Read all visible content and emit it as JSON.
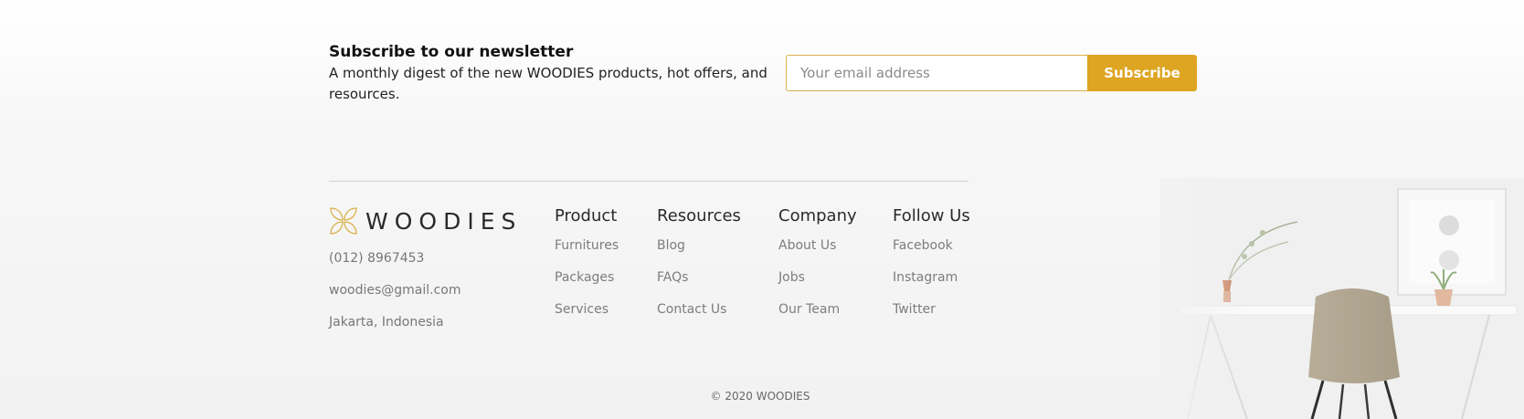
{
  "newsletter": {
    "title": "Subscribe to our newsletter",
    "description": "A monthly digest of the new WOODIES products, hot offers, and resources.",
    "email_placeholder": "Your email address",
    "subscribe_label": "Subscribe"
  },
  "brand": {
    "name": "WOODIES"
  },
  "contact": {
    "phone": "(012) 8967453",
    "email": "woodies@gmail.com",
    "location": "Jakarta, Indonesia"
  },
  "columns": [
    {
      "title": "Product",
      "links": [
        "Furnitures",
        "Packages",
        "Services"
      ]
    },
    {
      "title": "Resources",
      "links": [
        "Blog",
        "FAQs",
        "Contact Us"
      ]
    },
    {
      "title": "Company",
      "links": [
        "About Us",
        "Jobs",
        "Our Team"
      ]
    },
    {
      "title": "Follow Us",
      "links": [
        "Facebook",
        "Instagram",
        "Twitter"
      ]
    }
  ],
  "copyright": "© 2020 WOODIES",
  "colors": {
    "accent": "#dea522",
    "input_border": "#d6b24a",
    "logo": "#d9b24c"
  },
  "icons": {
    "logo": "petal-flower-logo-icon"
  }
}
